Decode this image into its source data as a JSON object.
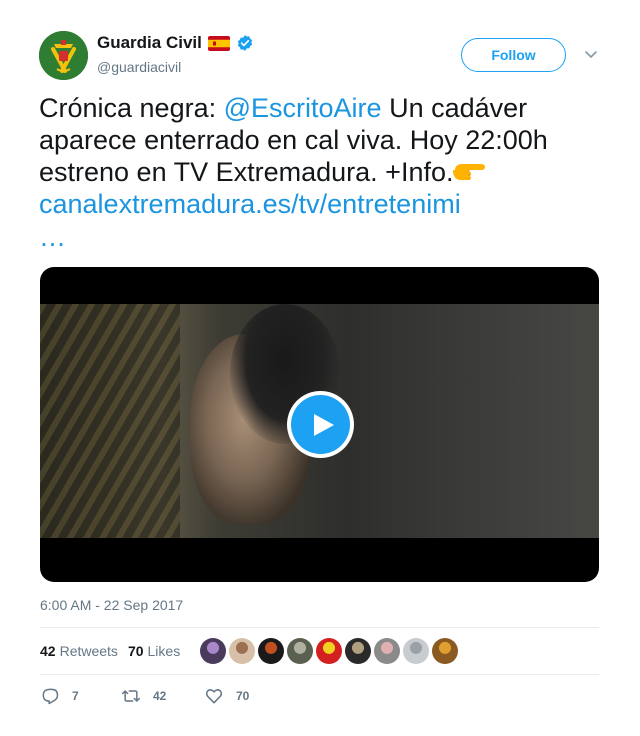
{
  "user": {
    "name": "Guardia Civil",
    "handle": "@guardiacivil",
    "avatar_icon": "guardia-civil-emblem",
    "flag_icon": "spain-flag",
    "verified_icon": "verified-badge"
  },
  "follow_button": {
    "label": "Follow"
  },
  "menu": {
    "icon": "chevron-down-icon"
  },
  "tweet": {
    "text_prefix": "Crónica negra: ",
    "mention": "@EscritoAire",
    "text_middle": " Un cadáver aparece enterrado en cal viva. Hoy 22:00h estreno en TV Extremadura. +Info.",
    "emoji": "pointing-right-hand",
    "link": "canalextremadura.es/tv/entretenimi",
    "ellipsis": "…"
  },
  "media": {
    "type": "video",
    "play_icon": "play-icon"
  },
  "timestamp": "6:00 AM - 22 Sep 2017",
  "stats": {
    "retweets_count": "42",
    "retweets_label": "Retweets",
    "likes_count": "70",
    "likes_label": "Likes",
    "likers": [
      {
        "color": "#4a3a5c",
        "accent": "#a888c8"
      },
      {
        "color": "#d8c0a8",
        "accent": "#9a7050"
      },
      {
        "color": "#1a1a1a",
        "accent": "#c05020"
      },
      {
        "color": "#5a6050",
        "accent": "#b0b0a0"
      },
      {
        "color": "#d42020",
        "accent": "#f0d020"
      },
      {
        "color": "#2a2a2a",
        "accent": "#b0a080"
      },
      {
        "color": "#8a8a8a",
        "accent": "#e0b0b0"
      },
      {
        "color": "#c8ccd0",
        "accent": "#9aa0a8"
      },
      {
        "color": "#8a5a20",
        "accent": "#e0a030"
      }
    ]
  },
  "actions": {
    "reply_count": "7",
    "retweet_count": "42",
    "like_count": "70"
  },
  "colors": {
    "link": "#1b95e0",
    "accent": "#1da1f2",
    "secondary_text": "#657786",
    "divider": "#e6ecf0"
  }
}
